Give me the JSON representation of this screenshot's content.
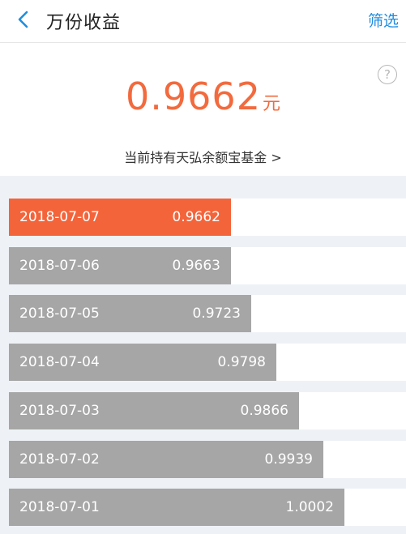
{
  "header": {
    "title": "万份收益",
    "filter_label": "筛选"
  },
  "help_icon_glyph": "?",
  "summary": {
    "value": "0.9662",
    "unit": "元",
    "fund_link": "当前持有天弘余额宝基金 >"
  },
  "colors": {
    "accent": "#f26a3d",
    "link": "#1f8ddf",
    "bar_active": "#f4643a",
    "bar_default": "#a6a6a6"
  },
  "rows": [
    {
      "date": "2018-07-07",
      "value": "0.9662",
      "level": 0.9662,
      "active": true
    },
    {
      "date": "2018-07-06",
      "value": "0.9663",
      "level": 0.9663,
      "active": false
    },
    {
      "date": "2018-07-05",
      "value": "0.9723",
      "level": 0.9723,
      "active": false
    },
    {
      "date": "2018-07-04",
      "value": "0.9798",
      "level": 0.9798,
      "active": false
    },
    {
      "date": "2018-07-03",
      "value": "0.9866",
      "level": 0.9866,
      "active": false
    },
    {
      "date": "2018-07-02",
      "value": "0.9939",
      "level": 0.9939,
      "active": false
    },
    {
      "date": "2018-07-01",
      "value": "1.0002",
      "level": 1.0002,
      "active": false
    }
  ]
}
